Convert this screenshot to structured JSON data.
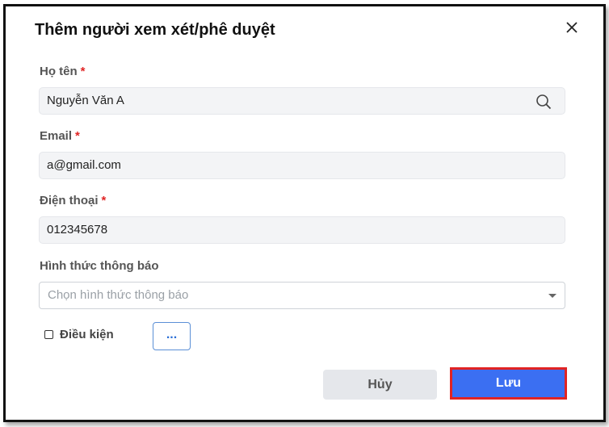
{
  "dialog": {
    "title": "Thêm người xem xét/phê duyệt",
    "close_icon": "close-icon"
  },
  "form": {
    "required_mark": "*",
    "full_name": {
      "label": "Họ tên",
      "value": "Nguyễn Văn A",
      "icon": "search-icon"
    },
    "email": {
      "label": "Email",
      "value": "a@gmail.com"
    },
    "phone": {
      "label": "Điện thoại",
      "value": "012345678"
    },
    "notification": {
      "label": "Hình thức thông báo",
      "placeholder": "Chọn hình thức thông báo"
    },
    "condition": {
      "label": "Điều kiện",
      "checked": false,
      "button_label": "..."
    }
  },
  "footer": {
    "cancel_label": "Hủy",
    "save_label": "Lưu"
  },
  "colors": {
    "primary": "#3b6ff2",
    "required": "#e02424",
    "highlight_border": "#e02424",
    "input_bg": "#f3f4f6"
  }
}
